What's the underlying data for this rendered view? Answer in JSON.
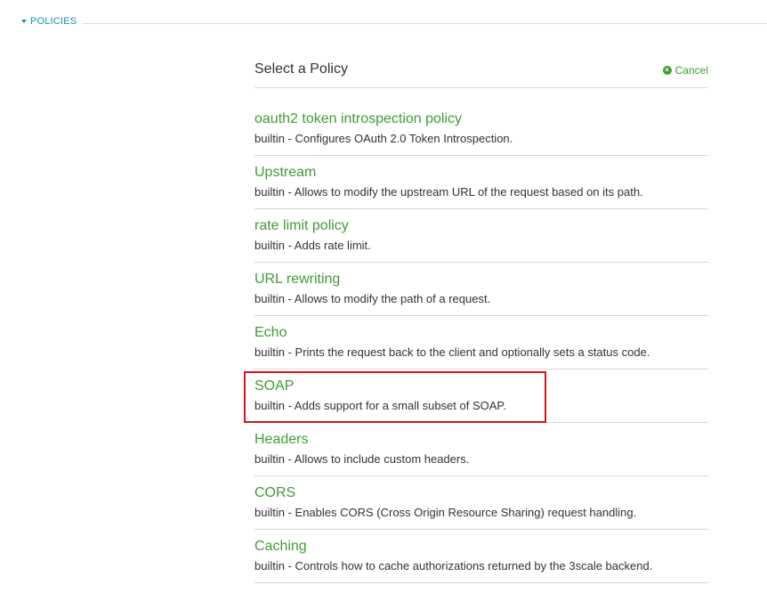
{
  "section": {
    "label": "POLICIES"
  },
  "panel": {
    "title": "Select a Policy",
    "cancel_label": "Cancel"
  },
  "policies": [
    {
      "name": "oauth2 token introspection policy",
      "description": "builtin - Configures OAuth 2.0 Token Introspection."
    },
    {
      "name": "Upstream",
      "description": "builtin - Allows to modify the upstream URL of the request based on its path."
    },
    {
      "name": "rate limit policy",
      "description": "builtin - Adds rate limit."
    },
    {
      "name": "URL rewriting",
      "description": "builtin - Allows to modify the path of a request."
    },
    {
      "name": "Echo",
      "description": "builtin - Prints the request back to the client and optionally sets a status code."
    },
    {
      "name": "SOAP",
      "description": "builtin - Adds support for a small subset of SOAP."
    },
    {
      "name": "Headers",
      "description": "builtin - Allows to include custom headers."
    },
    {
      "name": "CORS",
      "description": "builtin - Enables CORS (Cross Origin Resource Sharing) request handling."
    },
    {
      "name": "Caching",
      "description": "builtin - Controls how to cache authorizations returned by the 3scale backend."
    }
  ],
  "colors": {
    "accent_blue": "#1a8cb8",
    "policy_green": "#3f9c35",
    "highlight_red": "#d9141e"
  },
  "highlighted_policy": "SOAP"
}
